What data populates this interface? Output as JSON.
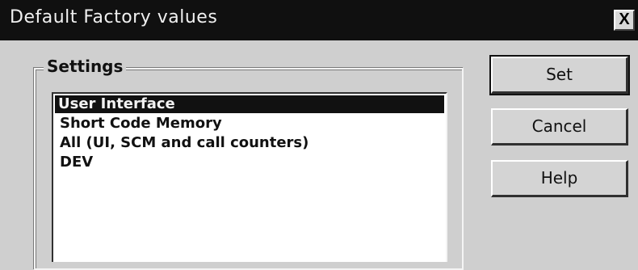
{
  "dialog": {
    "title": "Default Factory values",
    "close_label": "X"
  },
  "settings": {
    "group_label": "Settings",
    "items": [
      {
        "label": "User Interface",
        "selected": true
      },
      {
        "label": "Short Code Memory",
        "selected": false
      },
      {
        "label": "All (UI, SCM and call counters)",
        "selected": false
      },
      {
        "label": "DEV",
        "selected": false
      }
    ]
  },
  "buttons": {
    "set_label": "Set",
    "cancel_label": "Cancel",
    "help_label": "Help"
  }
}
